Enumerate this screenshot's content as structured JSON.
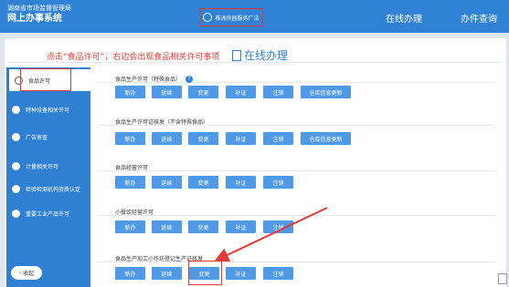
{
  "header": {
    "org": "湖南省市场监督管理局",
    "system": "网上办事系统",
    "user": "株洲良园服务厂法",
    "nav": [
      "在线办理",
      "办件查询"
    ]
  },
  "annotation": "点击“食品许可”，右边会出现食品相关许可事项",
  "page_title": "在线办理",
  "sidebar": {
    "items": [
      "食品许可",
      "特种设备相关许可",
      "广告审查",
      "计量相关许可",
      "检验检测机构资质认定",
      "重要工业产品许可"
    ],
    "collapse": "收起"
  },
  "sections": [
    {
      "title": "食品生产许可（特殊食品）",
      "buttons": [
        "新办",
        "延续",
        "变更",
        "补证",
        "注销",
        "仓库信息更新"
      ]
    },
    {
      "title": "食品生产许可证核发（不含特殊食品）",
      "buttons": [
        "新办",
        "延续",
        "变更",
        "补证",
        "注销",
        "仓库信息更新"
      ]
    },
    {
      "title": "食品经营许可",
      "buttons": [
        "新办",
        "延续",
        "变更",
        "补证",
        "注销"
      ]
    },
    {
      "title": "小餐饮经营许可",
      "buttons": [
        "新办",
        "延续",
        "变更",
        "补证",
        "注销"
      ]
    },
    {
      "title": "食品生产加工小作坊登记生产证核发",
      "buttons": [
        "新办",
        "延续",
        "变更",
        "补证",
        "注销"
      ]
    }
  ],
  "colors": {
    "primary": "#2f82d6",
    "button": "#4f99e6",
    "highlight": "#e53935"
  }
}
